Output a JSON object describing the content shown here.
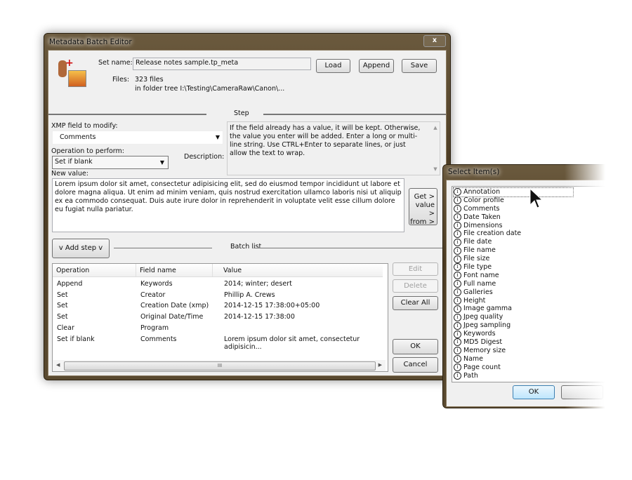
{
  "main_dialog": {
    "title": "Metadata Batch Editor",
    "close_label": "x",
    "set_name_label": "Set name:",
    "set_name_value": "Release notes sample.tp_meta",
    "load_label": "Load",
    "append_label": "Append",
    "save_label": "Save",
    "files_label": "Files:",
    "files_count": "323 files",
    "files_folder": "in folder tree I:\\Testing\\CameraRaw\\Canon\\...",
    "step_header": "Step",
    "xmp_field_label": "XMP field to modify:",
    "xmp_field_value": "Comments",
    "operation_label": "Operation to perform:",
    "operation_value": "Set if blank",
    "description_label": "Description:",
    "description_text": "If the field already has a value, it will be kept. Otherwise, the value you enter will be added. Enter a long or multi-line string. Use CTRL+Enter to separate lines, or just allow the text to wrap.",
    "new_value_label": "New value:",
    "new_value_text": "Lorem ipsum dolor sit amet, consectetur adipisicing elit, sed do eiusmod tempor incididunt ut labore et dolore magna aliqua. Ut enim ad minim veniam, quis nostrud exercitation ullamco laboris nisi ut aliquip ex ea commodo consequat. Duis aute irure dolor in reprehenderit in voluptate velit esse cillum dolore eu fugiat nulla pariatur.",
    "get_value_lines": [
      "Get >",
      "value >",
      "from >"
    ],
    "add_step_label": "v Add step v",
    "batch_list_header": "Batch list",
    "columns": [
      "Operation",
      "Field name",
      "Value"
    ],
    "rows": [
      [
        "Append",
        "Keywords",
        "2014; winter; desert"
      ],
      [
        "Set",
        "Creator",
        "Phillip A. Crews"
      ],
      [
        "Set",
        "Creation Date (xmp)",
        "2014-12-15  17:38:00+05:00"
      ],
      [
        "Set",
        "Original Date/Time",
        "2014-12-15  17:38:00"
      ],
      [
        "Clear",
        "Program",
        ""
      ],
      [
        "Set if blank",
        "Comments",
        "Lorem ipsum dolor sit amet, consectetur adipisicin..."
      ]
    ],
    "edit_label": "Edit",
    "delete_label": "Delete",
    "clear_all_label": "Clear All",
    "ok_label": "OK",
    "cancel_label": "Cancel",
    "scroll_grip": "III"
  },
  "select_dialog": {
    "title": "Select Item(s)",
    "items": [
      "Annotation",
      "Color profile",
      "Comments",
      "Date Taken",
      "Dimensions",
      "File creation date",
      "File date",
      "File name",
      "File size",
      "File type",
      "Font name",
      "Full name",
      "Galleries",
      "Height",
      "Image gamma",
      "Jpeg quality",
      "Jpeg sampling",
      "Keywords",
      "MD5 Digest",
      "Memory size",
      "Name",
      "Page count",
      "Path"
    ],
    "selected_item": "Annotation",
    "ok_label": "OK"
  }
}
